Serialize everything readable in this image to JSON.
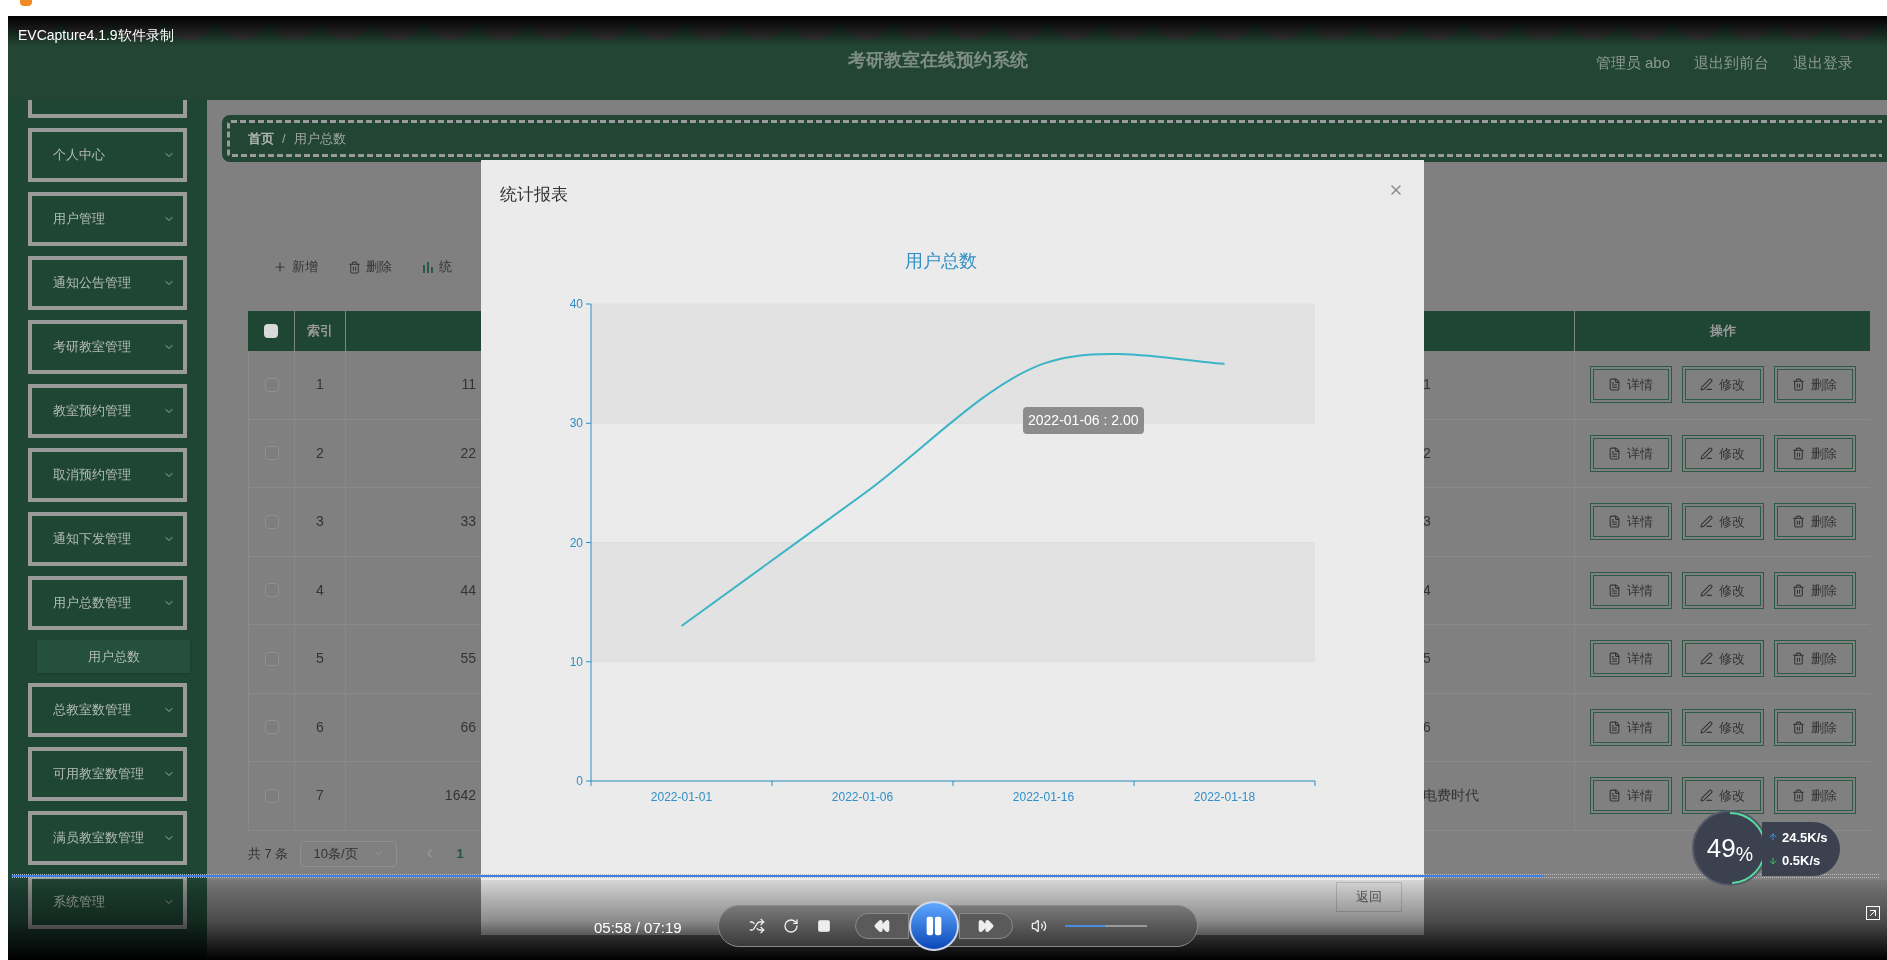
{
  "recorder": {
    "label": "EVCapture4.1.9软件录制"
  },
  "header": {
    "title": "考研教室在线预约系统",
    "links": [
      "管理员 abo",
      "退出到前台",
      "退出登录"
    ]
  },
  "sidebar": {
    "items": [
      {
        "label": "个人中心"
      },
      {
        "label": "用户管理"
      },
      {
        "label": "通知公告管理"
      },
      {
        "label": "考研教室管理"
      },
      {
        "label": "教室预约管理"
      },
      {
        "label": "取消预约管理"
      },
      {
        "label": "通知下发管理"
      },
      {
        "label": "用户总数管理",
        "children": [
          {
            "label": "用户总数",
            "selected": true
          }
        ]
      },
      {
        "label": "总教室数管理"
      },
      {
        "label": "可用教室数管理"
      },
      {
        "label": "满员教室数管理"
      },
      {
        "label": "系统管理"
      }
    ]
  },
  "breadcrumb": {
    "items": [
      "首页",
      "用户总数"
    ],
    "separator": "/"
  },
  "toolbar": [
    {
      "kind": "add",
      "label": "新增"
    },
    {
      "kind": "delete",
      "label": "删除"
    },
    {
      "kind": "chart",
      "label": "统"
    }
  ],
  "table": {
    "select_all_checked": false,
    "index_heading": "索引",
    "actions_heading": "操作",
    "rows": [
      {
        "checked": false,
        "index": "1",
        "column_3": "11",
        "column_4": "1",
        "actions": [
          {
            "kind": "detail",
            "label": "详情"
          },
          {
            "kind": "edit",
            "label": "修改"
          },
          {
            "kind": "delete",
            "label": "删除"
          }
        ]
      },
      {
        "checked": false,
        "index": "2",
        "column_3": "22",
        "column_4": "2",
        "actions": [
          {
            "kind": "detail",
            "label": "详情"
          },
          {
            "kind": "edit",
            "label": "修改"
          },
          {
            "kind": "delete",
            "label": "删除"
          }
        ]
      },
      {
        "checked": false,
        "index": "3",
        "column_3": "33",
        "column_4": "3",
        "actions": [
          {
            "kind": "detail",
            "label": "详情"
          },
          {
            "kind": "edit",
            "label": "修改"
          },
          {
            "kind": "delete",
            "label": "删除"
          }
        ]
      },
      {
        "checked": false,
        "index": "4",
        "column_3": "44",
        "column_4": "4",
        "actions": [
          {
            "kind": "detail",
            "label": "详情"
          },
          {
            "kind": "edit",
            "label": "修改"
          },
          {
            "kind": "delete",
            "label": "删除"
          }
        ]
      },
      {
        "checked": false,
        "index": "5",
        "column_3": "55",
        "column_4": "5",
        "actions": [
          {
            "kind": "detail",
            "label": "详情"
          },
          {
            "kind": "edit",
            "label": "修改"
          },
          {
            "kind": "delete",
            "label": "删除"
          }
        ]
      },
      {
        "checked": false,
        "index": "6",
        "column_3": "66",
        "column_4": "6",
        "actions": [
          {
            "kind": "detail",
            "label": "详情"
          },
          {
            "kind": "edit",
            "label": "修改"
          },
          {
            "kind": "delete",
            "label": "删除"
          }
        ]
      },
      {
        "checked": false,
        "index": "7",
        "column_3": "1642",
        "column_4": "电费时代",
        "actions": [
          {
            "kind": "detail",
            "label": "详情"
          },
          {
            "kind": "edit",
            "label": "修改"
          },
          {
            "kind": "delete",
            "label": "删除"
          }
        ]
      }
    ]
  },
  "pagination": {
    "total": "共 7 条",
    "page_size": "10条/页",
    "pages": [
      {
        "label": "1",
        "selected": true
      }
    ]
  },
  "modal": {
    "title": "统计报表",
    "buttons": [
      "返回"
    ],
    "chart_data": {
      "type": "line",
      "title": "用户总数",
      "categories": [
        "2022-01-01",
        "2022-01-06",
        "2022-01-16",
        "2022-01-18"
      ],
      "series": [
        {
          "color": "#3bb4c6",
          "values": [
            13,
            24,
            35,
            35
          ]
        }
      ],
      "ylim": [
        0,
        40
      ],
      "yticks": [
        0,
        10,
        20,
        30,
        40
      ],
      "annotations": [
        "2022-01-06 : 2.00"
      ]
    }
  },
  "player": {
    "time": "05:58 / 07:19",
    "playing": true,
    "progress": {
      "level": 0.82
    },
    "volume": {
      "level": 0.49
    }
  },
  "monitor": {
    "usage": {
      "level": 0.49,
      "reading": "49$_{%}$"
    },
    "upload": "24.5K/s",
    "download": "0.5K/s"
  }
}
